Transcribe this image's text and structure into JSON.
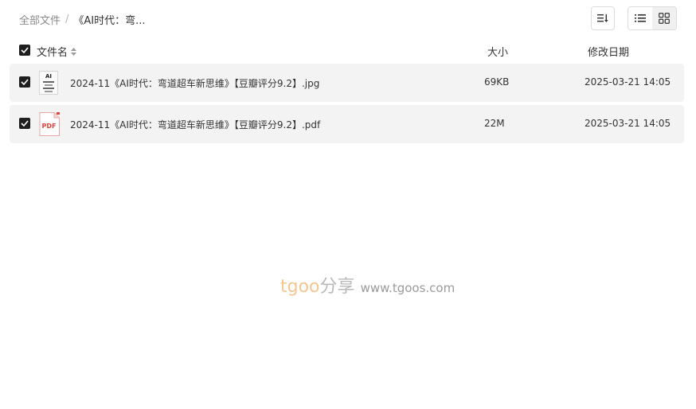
{
  "breadcrumb": {
    "root": "全部文件",
    "separator": "/",
    "current": "《AI时代：弯..."
  },
  "table": {
    "columns": {
      "name": "文件名",
      "size": "大小",
      "date": "修改日期"
    },
    "rows": [
      {
        "name": "2024-11《AI时代：弯道超车新思维》【豆瓣评分9.2】.jpg",
        "size": "69KB",
        "date": "2025-03-21 14:05",
        "type": "jpg",
        "checked": true
      },
      {
        "name": "2024-11《AI时代：弯道超车新思维》【豆瓣评分9.2】.pdf",
        "size": "22M",
        "date": "2025-03-21 14:05",
        "type": "pdf",
        "checked": true
      }
    ]
  },
  "thumb": {
    "jpg_label": "AI",
    "pdf_label": "PDF"
  },
  "watermark": {
    "brand": "tgoo",
    "share": "分享",
    "url": "www.tgoos.com"
  },
  "colors": {
    "row_bg": "#f3f3f3",
    "checkbox": "#1f1f1f",
    "pdf_red": "#e0433b",
    "watermark_orange": "#f3c78f"
  },
  "icons": [
    "sort-icon",
    "list-view-icon",
    "grid-view-icon",
    "sort-caret-icon",
    "checkbox-icon",
    "pdf-file-icon",
    "image-file-icon"
  ]
}
